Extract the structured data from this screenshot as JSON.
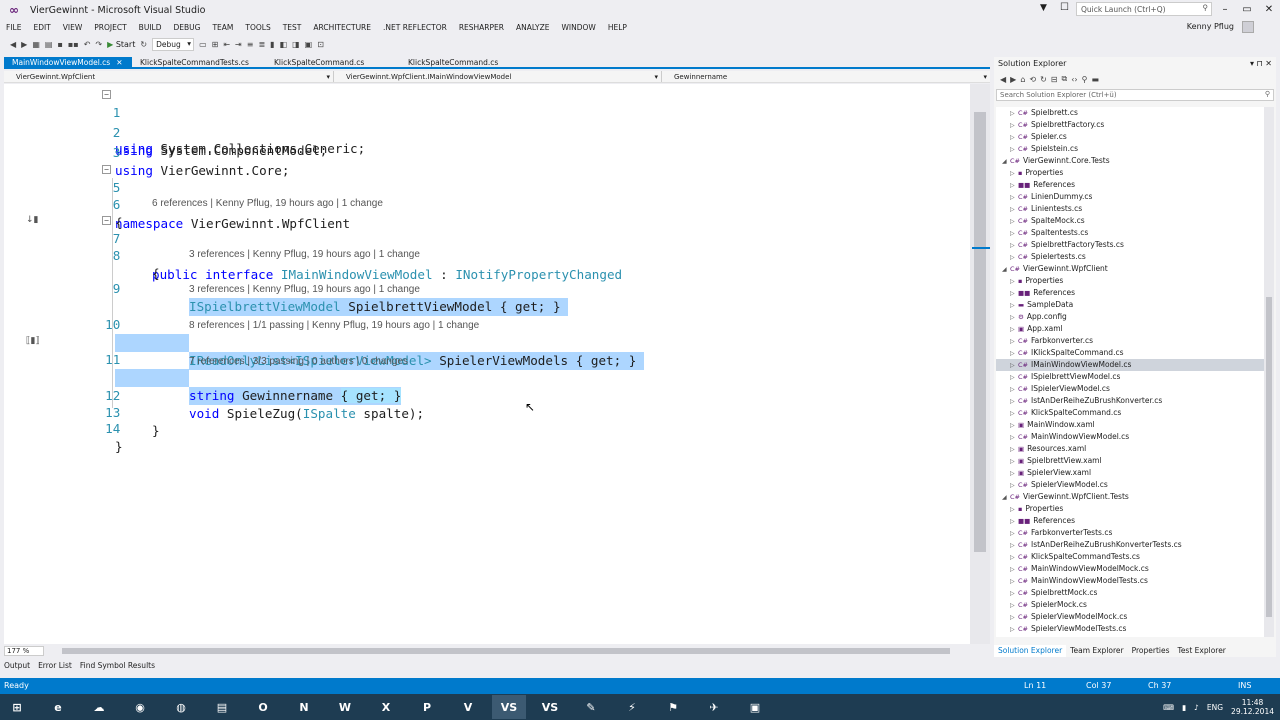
{
  "window": {
    "title": "VierGewinnt - Microsoft Visual Studio",
    "user": "Kenny Pflug",
    "quick_launch_placeholder": "Quick Launch (Ctrl+Q)"
  },
  "menu": [
    "FILE",
    "EDIT",
    "VIEW",
    "PROJECT",
    "BUILD",
    "DEBUG",
    "TEAM",
    "TOOLS",
    "TEST",
    "ARCHITECTURE",
    ".NET REFLECTOR",
    "RESHARPER",
    "ANALYZE",
    "WINDOW",
    "HELP"
  ],
  "toolbar": {
    "start_label": "Start",
    "config": "Debug"
  },
  "tabs": [
    {
      "label": "MainWindowViewModel.cs",
      "active": true
    },
    {
      "label": "KlickSpalteCommandTests.cs",
      "active": false
    },
    {
      "label": "KlickSpalteCommand.cs",
      "active": false
    },
    {
      "label": "KlickSpalteCommand.cs",
      "active": false
    }
  ],
  "navbar": {
    "project": "VierGewinnt.WpfClient",
    "type": "VierGewinnt.WpfClient.IMainWindowViewModel",
    "member": "Gewinnername"
  },
  "code": {
    "l1": {
      "n": "1",
      "kw": "using",
      "rest": " System.Collections.Generic;"
    },
    "l2": {
      "n": "2",
      "kw": "using",
      "rest": " System.ComponentModel;"
    },
    "l3": {
      "n": "3",
      "kw": "using",
      "rest": " VierGewinnt.Core;"
    },
    "l5": {
      "n": "5",
      "kw": "namespace",
      "rest": " VierGewinnt.WpfClient"
    },
    "l6": {
      "n": "6",
      "text": "{"
    },
    "lens7": "6 references | Kenny Pflug, 19 hours ago | 1 change",
    "l7": {
      "n": "7",
      "kw": "public interface",
      "ty": " IMainWindowViewModel",
      "mid": " : ",
      "ty2": "INotifyPropertyChanged"
    },
    "l8": {
      "n": "8",
      "text": "{"
    },
    "lens9": "3 references | Kenny Pflug, 19 hours ago | 1 change",
    "l9": {
      "n": "9",
      "ty": "ISpielbrettViewModel",
      "rest": " SpielbrettViewModel { get; }"
    },
    "lens10": "3 references | Kenny Pflug, 19 hours ago | 1 change",
    "l10": {
      "n": "10",
      "ty": "IReadOnlyList<ISpielerViewModel>",
      "rest": " SpielerViewModels { get; }"
    },
    "lens11": "8 references | 1/1 passing | Kenny Pflug, 19 hours ago | 1 change",
    "l11": {
      "n": "11",
      "kw": "string",
      "rest": " Gewinnername ",
      "br": "{ get; }"
    },
    "lens12": "7 references | 3/3 passing | 0 authors | 0 changes",
    "l12": {
      "n": "12",
      "kw": "void",
      "rest": " SpieleZug(",
      "ty": "ISpalte",
      "rest2": " spalte);"
    },
    "l13": {
      "n": "13",
      "text": "}"
    },
    "l14": {
      "n": "14",
      "text": "}"
    }
  },
  "zoom": "177 %",
  "bottom_tabs": [
    "Output",
    "Error List",
    "Find Symbol Results"
  ],
  "solution_explorer": {
    "title": "Solution Explorer",
    "search_placeholder": "Search Solution Explorer (Ctrl+ü)",
    "items": [
      {
        "label": "Spielbrett.cs",
        "indent": 2,
        "icon": "C#"
      },
      {
        "label": "SpielbrettFactory.cs",
        "indent": 2,
        "icon": "C#"
      },
      {
        "label": "Spieler.cs",
        "indent": 2,
        "icon": "C#"
      },
      {
        "label": "Spielstein.cs",
        "indent": 2,
        "icon": "C#"
      },
      {
        "label": "VierGewinnt.Core.Tests",
        "indent": 1,
        "icon": "C#"
      },
      {
        "label": "Properties",
        "indent": 2,
        "icon": "▪"
      },
      {
        "label": "References",
        "indent": 2,
        "icon": "■■"
      },
      {
        "label": "LinienDummy.cs",
        "indent": 2,
        "icon": "C#"
      },
      {
        "label": "Linientests.cs",
        "indent": 2,
        "icon": "C#"
      },
      {
        "label": "SpalteMock.cs",
        "indent": 2,
        "icon": "C#"
      },
      {
        "label": "Spaltentests.cs",
        "indent": 2,
        "icon": "C#"
      },
      {
        "label": "SpielbrettFactoryTests.cs",
        "indent": 2,
        "icon": "C#"
      },
      {
        "label": "Spielertests.cs",
        "indent": 2,
        "icon": "C#"
      },
      {
        "label": "VierGewinnt.WpfClient",
        "indent": 1,
        "icon": "C#"
      },
      {
        "label": "Properties",
        "indent": 2,
        "icon": "▪"
      },
      {
        "label": "References",
        "indent": 2,
        "icon": "■■"
      },
      {
        "label": "SampleData",
        "indent": 2,
        "icon": "▬"
      },
      {
        "label": "App.config",
        "indent": 2,
        "icon": "⚙"
      },
      {
        "label": "App.xaml",
        "indent": 2,
        "icon": "▣"
      },
      {
        "label": "Farbkonverter.cs",
        "indent": 2,
        "icon": "C#"
      },
      {
        "label": "IKlickSpalteCommand.cs",
        "indent": 2,
        "icon": "C#"
      },
      {
        "label": "IMainWindowViewModel.cs",
        "indent": 2,
        "icon": "C#",
        "selected": true
      },
      {
        "label": "ISpielbrettViewModel.cs",
        "indent": 2,
        "icon": "C#"
      },
      {
        "label": "ISpielerViewModel.cs",
        "indent": 2,
        "icon": "C#"
      },
      {
        "label": "IstAnDerReiheZuBrushKonverter.cs",
        "indent": 2,
        "icon": "C#"
      },
      {
        "label": "KlickSpalteCommand.cs",
        "indent": 2,
        "icon": "C#"
      },
      {
        "label": "MainWindow.xaml",
        "indent": 2,
        "icon": "▣"
      },
      {
        "label": "MainWindowViewModel.cs",
        "indent": 2,
        "icon": "C#"
      },
      {
        "label": "Resources.xaml",
        "indent": 2,
        "icon": "▣"
      },
      {
        "label": "SpielbrettView.xaml",
        "indent": 2,
        "icon": "▣"
      },
      {
        "label": "SpielerView.xaml",
        "indent": 2,
        "icon": "▣"
      },
      {
        "label": "SpielerViewModel.cs",
        "indent": 2,
        "icon": "C#"
      },
      {
        "label": "VierGewinnt.WpfClient.Tests",
        "indent": 1,
        "icon": "C#"
      },
      {
        "label": "Properties",
        "indent": 2,
        "icon": "▪"
      },
      {
        "label": "References",
        "indent": 2,
        "icon": "■■"
      },
      {
        "label": "FarbkonverterTests.cs",
        "indent": 2,
        "icon": "C#"
      },
      {
        "label": "IstAnDerReiheZuBrushKonverterTests.cs",
        "indent": 2,
        "icon": "C#"
      },
      {
        "label": "KlickSpalteCommandTests.cs",
        "indent": 2,
        "icon": "C#"
      },
      {
        "label": "MainWindowViewModelMock.cs",
        "indent": 2,
        "icon": "C#"
      },
      {
        "label": "MainWindowViewModelTests.cs",
        "indent": 2,
        "icon": "C#"
      },
      {
        "label": "SpielbrettMock.cs",
        "indent": 2,
        "icon": "C#"
      },
      {
        "label": "SpielerMock.cs",
        "indent": 2,
        "icon": "C#"
      },
      {
        "label": "SpielerViewModelMock.cs",
        "indent": 2,
        "icon": "C#"
      },
      {
        "label": "SpielerViewModelTests.cs",
        "indent": 2,
        "icon": "C#"
      }
    ],
    "tabs": [
      "Solution Explorer",
      "Team Explorer",
      "Properties",
      "Test Explorer"
    ]
  },
  "status": {
    "ready": "Ready",
    "ln": "Ln 11",
    "col": "Col 37",
    "ch": "Ch 37",
    "mode": "INS"
  },
  "taskbar": {
    "apps": [
      "⊞",
      "e",
      "☁",
      "◉",
      "◍",
      "▤",
      "O",
      "N",
      "W",
      "X",
      "P",
      "V",
      "VS",
      "VS",
      "✎",
      "⚡",
      "⚑",
      "✈",
      "▣"
    ],
    "lang": "ENG",
    "time": "11:48",
    "date": "29.12.2014"
  },
  "colors": {
    "accent": "#007acc",
    "keyword": "#0000ff",
    "type": "#2b91af",
    "highlight": "#add6ff"
  }
}
